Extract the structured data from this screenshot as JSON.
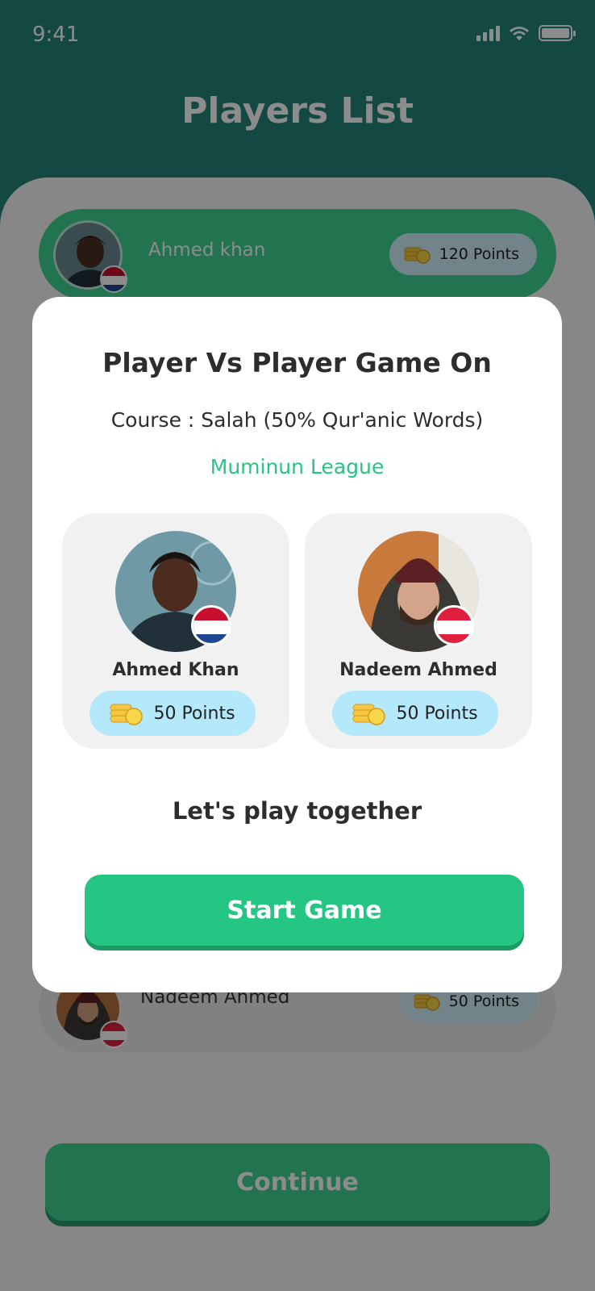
{
  "status_bar": {
    "time": "9:41"
  },
  "page": {
    "title": "Players List"
  },
  "players_list": [
    {
      "name": "Ahmed khan",
      "points": "120 Points",
      "flag": "netherlands-flag-icon"
    },
    {
      "name": "Nadeem Ahmed",
      "points": "50 Points",
      "flag": "austria-flag-icon"
    }
  ],
  "continue_label": "Continue",
  "modal": {
    "title": "Player Vs Player Game On",
    "course": "Course : Salah (50% Qur'anic Words)",
    "league": "Muminun League",
    "players": [
      {
        "name": "Ahmed Khan",
        "points": "50 Points",
        "flag": "netherlands-flag-icon"
      },
      {
        "name": "Nadeem Ahmed",
        "points": "50 Points",
        "flag": "austria-flag-icon"
      }
    ],
    "tagline": "Let's play together",
    "start_label": "Start Game"
  },
  "colors": {
    "brand_green": "#25c683",
    "header_teal": "#26857a",
    "points_blue": "#b4e8fb",
    "league_text": "#27c483"
  },
  "icons": {
    "coins": "coins-icon",
    "signal": "signal-icon",
    "wifi": "wifi-icon",
    "battery": "battery-icon"
  }
}
